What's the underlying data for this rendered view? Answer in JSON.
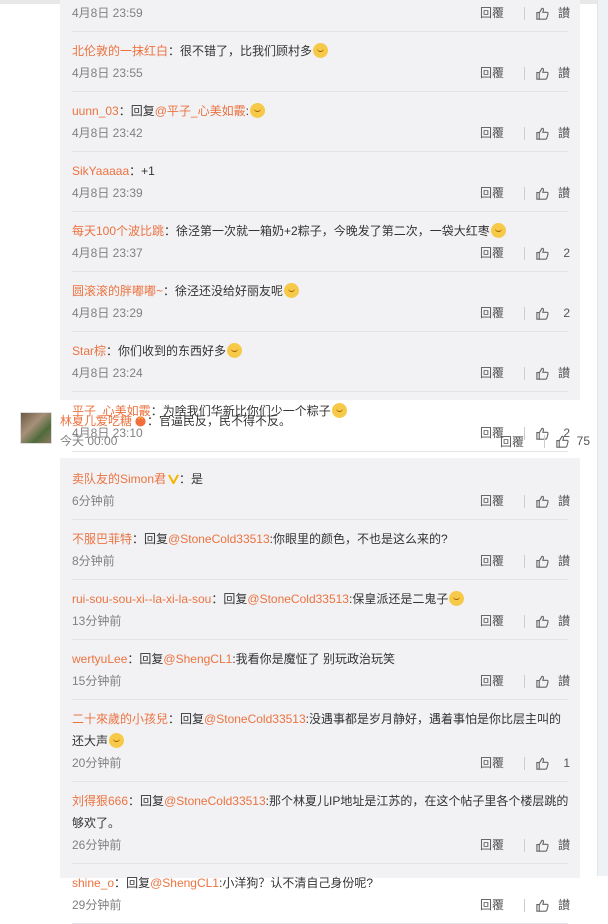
{
  "replies_top": [
    {
      "name": "",
      "text": "",
      "time": "4月8日 23:59",
      "reply": "回覆",
      "like": "讃",
      "count": "",
      "first": true
    },
    {
      "name": "北伦敦的一抹红白",
      "text": "很不错了，比我们顾村多",
      "emoji": "doge",
      "time": "4月8日 23:55",
      "reply": "回覆",
      "like": "讃",
      "count": ""
    },
    {
      "name": "uunn_03",
      "text": "回复",
      "at": "@平子_心美如霰",
      "text2": ":",
      "emoji": "laugh-cry",
      "time": "4月8日 23:42",
      "reply": "回覆",
      "like": "讃",
      "count": ""
    },
    {
      "name": "SikYaaaaa",
      "text": "+1",
      "time": "4月8日 23:39",
      "reply": "回覆",
      "like": "讃",
      "count": ""
    },
    {
      "name": "每天100个波比跳",
      "text": "徐泾第一次就一箱奶+2粽子，今晚发了第二次，一袋大红枣",
      "emoji": "smile",
      "time": "4月8日 23:37",
      "reply": "回覆",
      "like": "讃",
      "count": "2"
    },
    {
      "name": "圆滚滚的胖嘟嘟~",
      "text": "徐泾还没给好丽友呢",
      "emoji": "laugh-cry",
      "time": "4月8日 23:29",
      "reply": "回覆",
      "like": "讃",
      "count": "2"
    },
    {
      "name": "Star棕",
      "text": "你们收到的东西好多",
      "emoji": "laugh-cry",
      "time": "4月8日 23:24",
      "reply": "回覆",
      "like": "讃",
      "count": ""
    },
    {
      "name": "平子_心美如霰",
      "text": "为啥我们华新比你们少一个粽子",
      "emoji": "laugh-cry",
      "time": "4月8日 23:10",
      "reply": "回覆",
      "like": "讃",
      "count": "2"
    }
  ],
  "main_comment": {
    "name": "林夏儿爱吃糖",
    "text": "官逼民反，民不得不反。",
    "time": "今天 00:00",
    "reply": "回覆",
    "count": "75"
  },
  "replies_bottom": [
    {
      "name": "卖队友的Simon君",
      "badge": "v-icon",
      "text": "是",
      "time": "6分钟前",
      "reply": "回覆",
      "like": "讃",
      "count": ""
    },
    {
      "name": "不服巴菲特",
      "text": "回复",
      "at": "@StoneCold33513",
      "text2": ":你眼里的颜色，不也是这么来的?",
      "time": "8分钟前",
      "reply": "回覆",
      "like": "讃",
      "count": ""
    },
    {
      "name": "rui-sou-sou-xi--la-xi-la-sou",
      "text": "回复",
      "at": "@StoneCold33513",
      "text2": ":保皇派还是二鬼子",
      "emoji": "doge",
      "time": "13分钟前",
      "reply": "回覆",
      "like": "讃",
      "count": ""
    },
    {
      "name": "wertyuLee",
      "text": "回复",
      "at": "@ShengCL1",
      "text2": ":我看你是魔怔了 别玩政治玩笑",
      "time": "15分钟前",
      "reply": "回覆",
      "like": "讃",
      "count": ""
    },
    {
      "name": "二十來歲的小孩兒",
      "text": "回复",
      "at": "@StoneCold33513",
      "text2": ":没遇事都是岁月静好，遇着事怕是你比层主叫的还大声",
      "emoji": "doge",
      "time": "20分钟前",
      "reply": "回覆",
      "like": "讃",
      "count": "1"
    },
    {
      "name": "刘得狠666",
      "text": "回复",
      "at": "@StoneCold33513",
      "text2": ":那个林夏儿IP地址是江苏的，在这个帖子里各个楼层跳的够欢了。",
      "time": "26分钟前",
      "reply": "回覆",
      "like": "讃",
      "count": ""
    },
    {
      "name": "shine_o",
      "text": "回复",
      "at": "@ShengCL1",
      "text2": ":小洋狗？认不清自己身份呢?",
      "time": "29分钟前",
      "reply": "回覆",
      "like": "讃",
      "count": ""
    }
  ],
  "colors": {
    "name": "#eb7340",
    "meta": "#808080",
    "panel": "#f2f2f5"
  }
}
